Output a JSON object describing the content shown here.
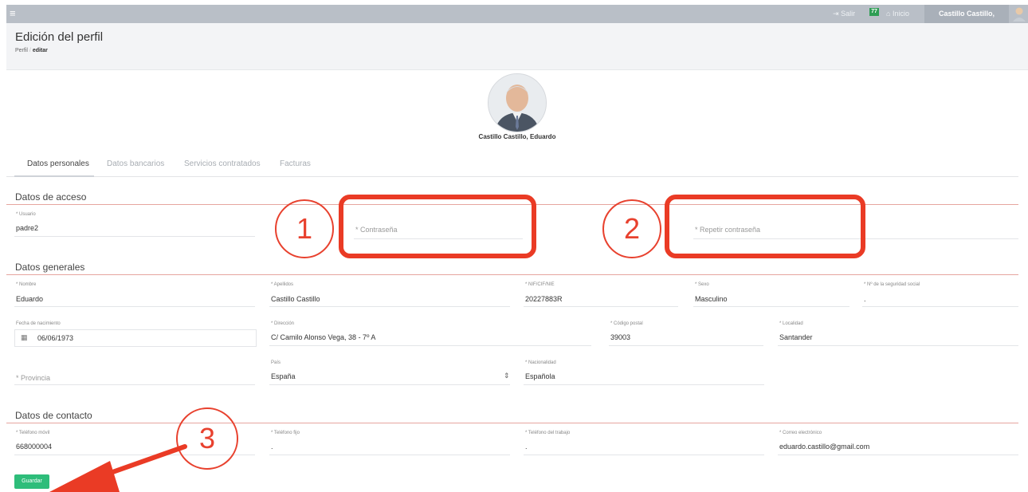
{
  "topbar": {
    "menu_glyph": "≡",
    "logout": "Salir",
    "badge": "77",
    "home": "Inicio",
    "user": "Castillo Castillo, Eduardo"
  },
  "header": {
    "title": "Edición del perfil",
    "breadcrumb_parent": "Perfil",
    "breadcrumb_sep": "/",
    "breadcrumb_current": "editar"
  },
  "profile": {
    "name": "Castillo Castillo, Eduardo"
  },
  "tabs": [
    "Datos personales",
    "Datos bancarios",
    "Servicios contratados",
    "Facturas"
  ],
  "sections": {
    "access": "Datos de acceso",
    "general": "Datos generales",
    "contact": "Datos de contacto"
  },
  "access": {
    "usuario_label": "* Usuario",
    "usuario_value": "padre2",
    "password_placeholder": "* Contraseña",
    "repeat_password_placeholder": "* Repetir contraseña"
  },
  "general": {
    "nombre_label": "* Nombre",
    "nombre_value": "Eduardo",
    "apellidos_label": "* Apellidos",
    "apellidos_value": "Castillo Castillo",
    "nif_label": "* NIF/CIF/NIE",
    "nif_value": "20227883R",
    "sexo_label": "* Sexo",
    "sexo_value": "Masculino",
    "ss_label": "* Nº de la seguridad social",
    "ss_value": ".",
    "fecha_label": "Fecha de nacimiento",
    "fecha_value": "06/06/1973",
    "direccion_label": "* Dirección",
    "direccion_value": "C/ Camilo Alonso Vega, 38 - 7º A",
    "cp_label": "* Código postal",
    "cp_value": "39003",
    "localidad_label": "* Localidad",
    "localidad_value": "Santander",
    "provincia_placeholder": "* Provincia",
    "pais_label": "País",
    "pais_value": "España",
    "nacionalidad_label": "* Nacionalidad",
    "nacionalidad_value": "Española"
  },
  "contact": {
    "movil_label": "* Teléfono móvil",
    "movil_value": "668000004",
    "fijo_label": "* Teléfono fijo",
    "fijo_value": ".",
    "trabajo_label": "* Teléfono del trabajo",
    "trabajo_value": ".",
    "email_label": "* Correo electrónico",
    "email_value": "eduardo.castillo@gmail.com"
  },
  "save_label": "Guardar",
  "annotations": [
    "1",
    "2",
    "3"
  ],
  "colors": {
    "annotation": "#ea3b25",
    "save": "#2ebd7a",
    "section_line": "#e6a59f"
  }
}
